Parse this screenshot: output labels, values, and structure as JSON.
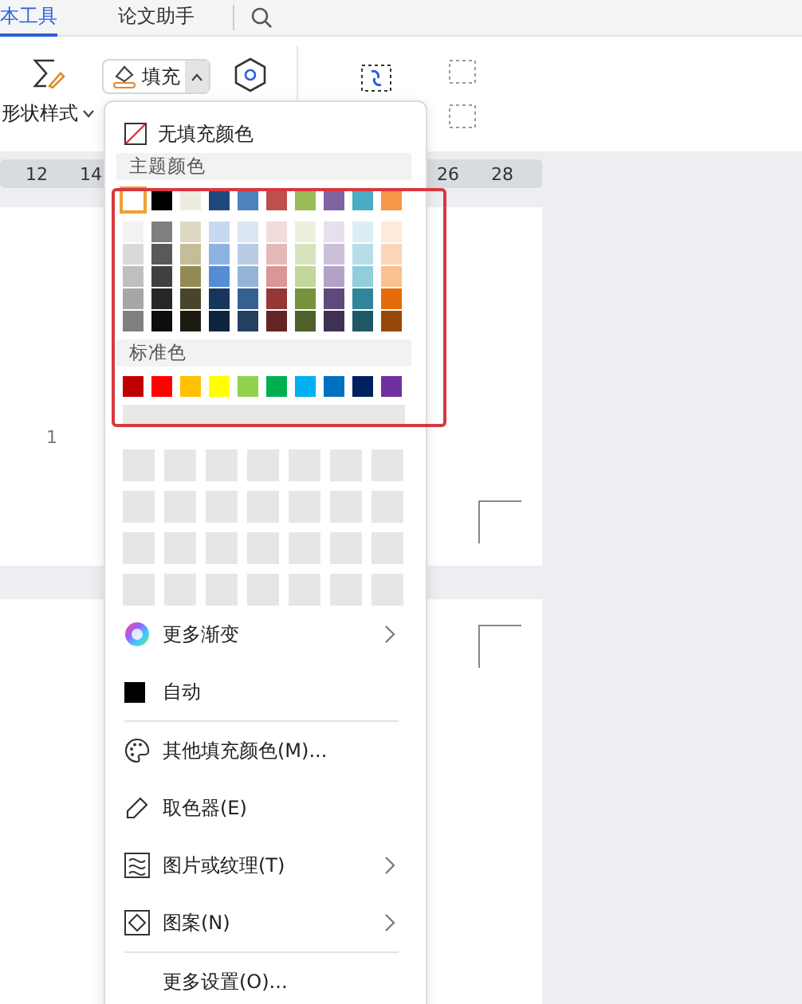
{
  "tabs": [
    {
      "label": "本工具",
      "selected": true
    },
    {
      "label": "论文助手",
      "selected": false
    }
  ],
  "ribbon": {
    "shape_style_label": "形状样式",
    "fill_button": {
      "label": "填充",
      "expanded": true
    }
  },
  "ruler": {
    "left_ticks": [
      "12",
      "14"
    ],
    "right_ticks": [
      "26",
      "28"
    ]
  },
  "page_number": "1",
  "fill_menu": {
    "no_fill_label": "无填充颜色",
    "theme_header": "主题颜色",
    "theme_colors": [
      {
        "color": "#ffffff",
        "selected": true
      },
      {
        "color": "#000000",
        "selected": false
      },
      {
        "color": "#eeece1",
        "selected": false
      },
      {
        "color": "#1f497d",
        "selected": false
      },
      {
        "color": "#4f81bd",
        "selected": false
      },
      {
        "color": "#c0504d",
        "selected": false
      },
      {
        "color": "#9bbb59",
        "selected": false
      },
      {
        "color": "#8064a2",
        "selected": false
      },
      {
        "color": "#4bacc6",
        "selected": false
      },
      {
        "color": "#f79646",
        "selected": false
      }
    ],
    "theme_shades": [
      [
        {
          "color": "#f2f2f2"
        },
        {
          "color": "#7f7f7f"
        },
        {
          "color": "#ddd9c3"
        },
        {
          "color": "#c6d9f0"
        },
        {
          "color": "#dbe5f1"
        },
        {
          "color": "#f2dcdb"
        },
        {
          "color": "#ebf1dd"
        },
        {
          "color": "#e5e0ec"
        },
        {
          "color": "#dbeef3"
        },
        {
          "color": "#fdeada"
        }
      ],
      [
        {
          "color": "#d9d9d9"
        },
        {
          "color": "#595959"
        },
        {
          "color": "#c4bd97"
        },
        {
          "color": "#8db3e2"
        },
        {
          "color": "#b8cce4"
        },
        {
          "color": "#e5b9b7"
        },
        {
          "color": "#d7e3bc"
        },
        {
          "color": "#ccc1d9"
        },
        {
          "color": "#b7dde8"
        },
        {
          "color": "#fbd5b5"
        }
      ],
      [
        {
          "color": "#bfbfbf"
        },
        {
          "color": "#404040"
        },
        {
          "color": "#948a54"
        },
        {
          "color": "#548dd4"
        },
        {
          "color": "#95b3d7"
        },
        {
          "color": "#d99694"
        },
        {
          "color": "#c3d69b"
        },
        {
          "color": "#b2a2c7"
        },
        {
          "color": "#92cddc"
        },
        {
          "color": "#fac08f"
        }
      ],
      [
        {
          "color": "#a6a6a6"
        },
        {
          "color": "#262626"
        },
        {
          "color": "#4a452a"
        },
        {
          "color": "#17365d"
        },
        {
          "color": "#366092"
        },
        {
          "color": "#953734"
        },
        {
          "color": "#76923c"
        },
        {
          "color": "#5f497a"
        },
        {
          "color": "#31859b"
        },
        {
          "color": "#e36c09"
        }
      ],
      [
        {
          "color": "#808080"
        },
        {
          "color": "#0d0d0d"
        },
        {
          "color": "#1d1b10"
        },
        {
          "color": "#0f243e"
        },
        {
          "color": "#244061"
        },
        {
          "color": "#632423"
        },
        {
          "color": "#4f6128"
        },
        {
          "color": "#3f3151"
        },
        {
          "color": "#205867"
        },
        {
          "color": "#974806"
        }
      ]
    ],
    "standard_header": "标准色",
    "standard_colors": [
      {
        "color": "#c00000"
      },
      {
        "color": "#ff0000"
      },
      {
        "color": "#ffc000"
      },
      {
        "color": "#ffff00"
      },
      {
        "color": "#92d050"
      },
      {
        "color": "#00b050"
      },
      {
        "color": "#00b0f0"
      },
      {
        "color": "#0070c0"
      },
      {
        "color": "#002060"
      },
      {
        "color": "#7030a0"
      }
    ],
    "items": [
      {
        "kind": "gradient",
        "label": "更多渐变",
        "submenu": true
      },
      {
        "kind": "auto",
        "label": "自动",
        "submenu": false
      },
      {
        "kind": "divider"
      },
      {
        "kind": "palette",
        "label": "其他填充颜色(M)...",
        "submenu": false
      },
      {
        "kind": "eyedropper",
        "label": "取色器(E)",
        "submenu": false
      },
      {
        "kind": "texture",
        "label": "图片或纹理(T)",
        "submenu": true
      },
      {
        "kind": "pattern",
        "label": "图案(N)",
        "submenu": true
      },
      {
        "kind": "divider"
      },
      {
        "kind": "plain",
        "label": "更多设置(O)...",
        "submenu": false
      }
    ]
  }
}
